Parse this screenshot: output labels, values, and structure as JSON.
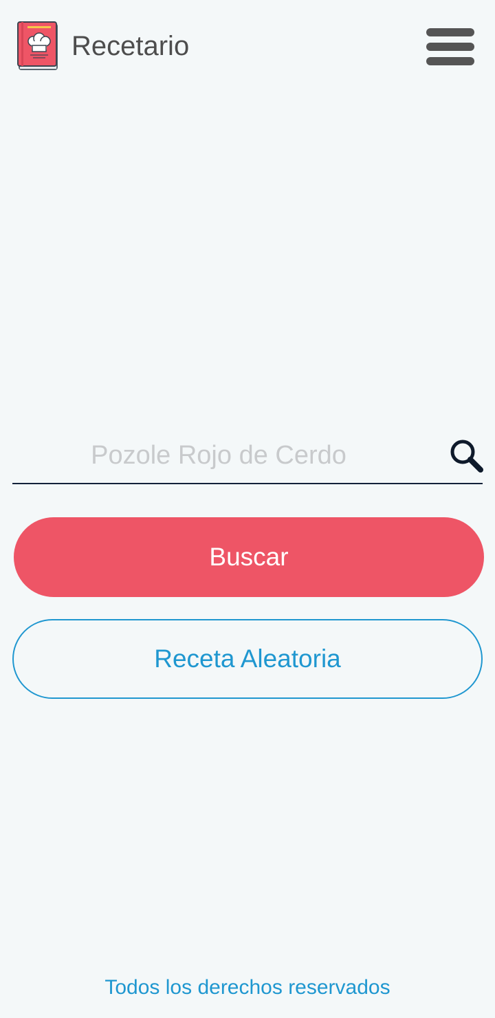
{
  "app": {
    "title": "Recetario",
    "logo_icon": "recipe-book-chef-hat-icon",
    "menu_icon": "hamburger-menu-icon"
  },
  "search": {
    "placeholder": "Pozole Rojo de Cerdo",
    "value": "",
    "icon": "search-icon"
  },
  "actions": {
    "search_label": "Buscar",
    "random_label": "Receta Aleatoria"
  },
  "footer": {
    "text": "Todos los derechos reservados"
  },
  "colors": {
    "background": "#f4f8f9",
    "primary": "#ee5566",
    "accent": "#1f97d0",
    "text_dark": "#4d4d4d"
  }
}
